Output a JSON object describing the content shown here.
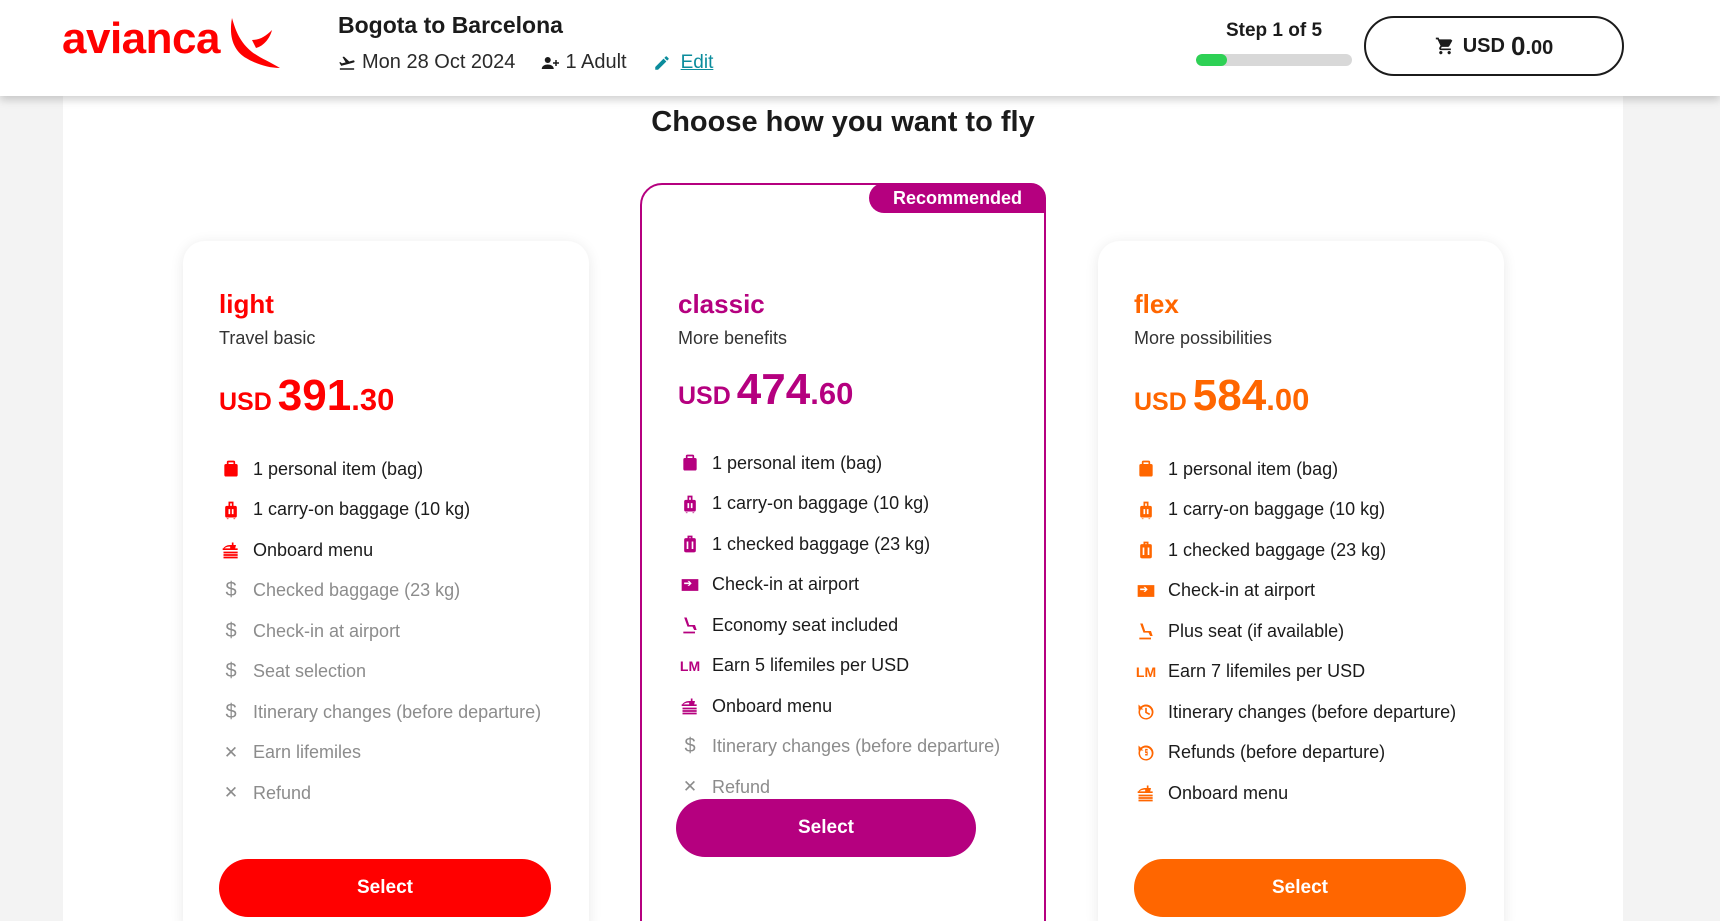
{
  "brand": {
    "name": "avianca",
    "color": "#ff0000"
  },
  "trip": {
    "title": "Bogota to Barcelona",
    "date": "Mon 28 Oct 2024",
    "passengers": "1 Adult",
    "edit_label": "Edit"
  },
  "step": {
    "label": "Step 1 of 5",
    "progress_fraction": 0.2,
    "color": "#2ed155"
  },
  "cart": {
    "currency": "USD",
    "amount_int": "0",
    "amount_dec": ".00"
  },
  "page": {
    "title": "Choose how you want to fly"
  },
  "fares": [
    {
      "name": "light",
      "subtitle": "Travel basic",
      "color": "#ff0000",
      "currency": "USD",
      "price_int": "391",
      "price_dec": ".30",
      "features": [
        {
          "icon": "bag-icon",
          "text": "1 personal item (bag)",
          "state": "included"
        },
        {
          "icon": "carry-on-icon",
          "text": "1 carry-on baggage (10 kg)",
          "state": "included"
        },
        {
          "icon": "menu-icon",
          "text": "Onboard menu",
          "state": "included"
        },
        {
          "icon": "dollar-icon",
          "text": "Checked baggage (23 kg)",
          "state": "paid"
        },
        {
          "icon": "dollar-icon",
          "text": "Check-in at airport",
          "state": "paid"
        },
        {
          "icon": "dollar-icon",
          "text": "Seat selection",
          "state": "paid"
        },
        {
          "icon": "dollar-icon",
          "text": "Itinerary changes (before departure)",
          "state": "paid"
        },
        {
          "icon": "x-icon",
          "text": "Earn lifemiles",
          "state": "none"
        },
        {
          "icon": "x-icon",
          "text": "Refund",
          "state": "none"
        }
      ],
      "select_label": "Select"
    },
    {
      "name": "classic",
      "subtitle": "More benefits",
      "color": "#b5007f",
      "badge": "Recommended",
      "currency": "USD",
      "price_int": "474",
      "price_dec": ".60",
      "features": [
        {
          "icon": "bag-icon",
          "text": "1 personal item (bag)",
          "state": "included"
        },
        {
          "icon": "carry-on-icon",
          "text": "1 carry-on baggage (10 kg)",
          "state": "included"
        },
        {
          "icon": "checked-bag-icon",
          "text": "1 checked baggage (23 kg)",
          "state": "included"
        },
        {
          "icon": "ticket-icon",
          "text": "Check-in at airport",
          "state": "included"
        },
        {
          "icon": "seat-icon",
          "text": "Economy seat included",
          "state": "included"
        },
        {
          "icon": "lm-icon",
          "text": "Earn 5 lifemiles per USD",
          "state": "included"
        },
        {
          "icon": "menu-icon",
          "text": "Onboard menu",
          "state": "included"
        },
        {
          "icon": "dollar-icon",
          "text": "Itinerary changes (before departure)",
          "state": "paid"
        },
        {
          "icon": "x-icon",
          "text": "Refund",
          "state": "none"
        }
      ],
      "select_label": "Select"
    },
    {
      "name": "flex",
      "subtitle": "More possibilities",
      "color": "#ff6600",
      "currency": "USD",
      "price_int": "584",
      "price_dec": ".00",
      "features": [
        {
          "icon": "bag-icon",
          "text": "1 personal item (bag)",
          "state": "included"
        },
        {
          "icon": "carry-on-icon",
          "text": "1 carry-on baggage (10 kg)",
          "state": "included"
        },
        {
          "icon": "checked-bag-icon",
          "text": "1 checked baggage (23 kg)",
          "state": "included"
        },
        {
          "icon": "ticket-icon",
          "text": "Check-in at airport",
          "state": "included"
        },
        {
          "icon": "seat-icon",
          "text": "Plus seat (if available)",
          "state": "included"
        },
        {
          "icon": "lm-icon",
          "text": "Earn 7 lifemiles per USD",
          "state": "included"
        },
        {
          "icon": "change-icon",
          "text": "Itinerary changes (before departure)",
          "state": "included"
        },
        {
          "icon": "refund-icon",
          "text": "Refunds (before departure)",
          "state": "included"
        },
        {
          "icon": "menu-icon",
          "text": "Onboard menu",
          "state": "included"
        }
      ],
      "select_label": "Select"
    }
  ]
}
